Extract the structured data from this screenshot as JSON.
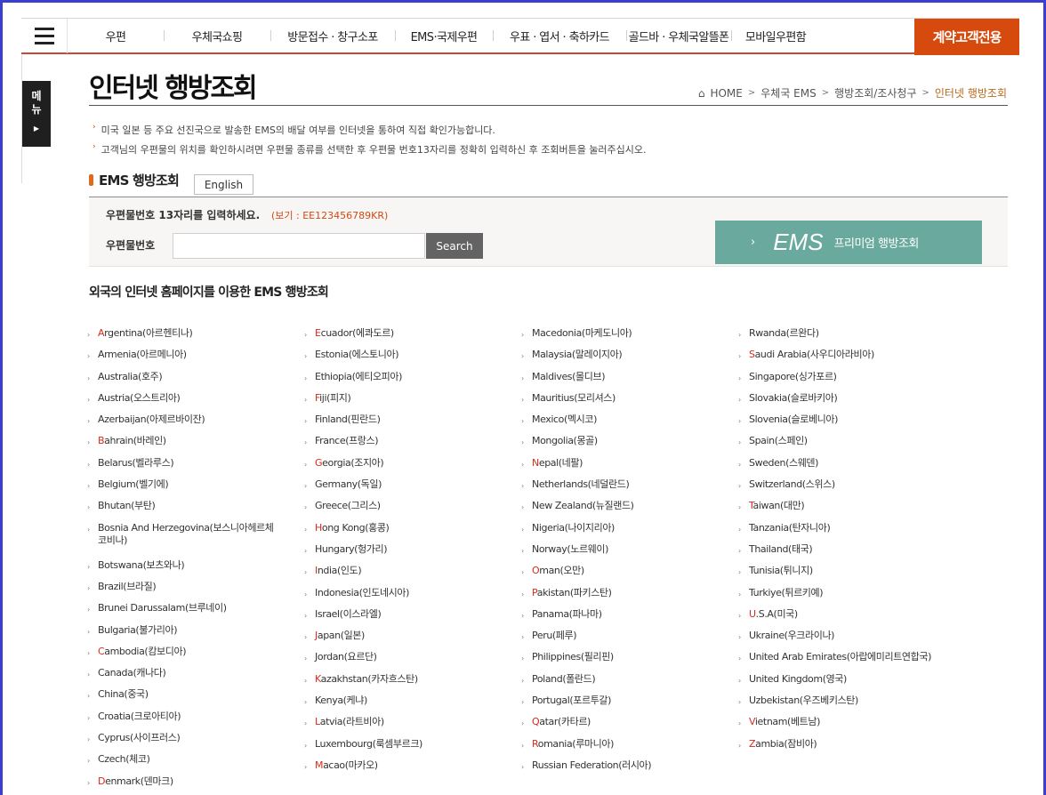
{
  "header": {
    "menu_icon": "hamburger-icon",
    "nav": [
      {
        "label": "우편"
      },
      {
        "label": "우체국쇼핑"
      },
      {
        "label": "방문접수 · 창구소포"
      },
      {
        "label": "EMS·국제우편"
      },
      {
        "label": "우표 · 엽서 · 축하카드"
      },
      {
        "label": "골드바 · 우체국알뜰폰"
      },
      {
        "label": "모바일우편함"
      }
    ],
    "special": "계약고객전용"
  },
  "side_tab": {
    "label1": "메",
    "label2": "뉴",
    "arrow": "▶"
  },
  "page": {
    "title": "인터넷 행방조회",
    "breadcrumb": {
      "home": "HOME",
      "items": [
        "우체국 EMS",
        "행방조회/조사청구"
      ],
      "current": "인터넷 행방조회"
    }
  },
  "notes": [
    "미국 일본 등 주요 선진국으로 발송한 EMS의 배달 여부를 인터넷을 통하여 직접 확인가능합니다.",
    "고객님의 우편물의 위치를 확인하시려면 우편물 종류를 선택한 후 우편물 번호13자리를 정확히 입력하신 후 조회버튼을 눌러주십시오."
  ],
  "ems": {
    "heading": "EMS 행방조회",
    "english_button": "English",
    "prompt": "우편물번호 13자리를 입력하세요.",
    "example": "(보기 : EE123456789KR)",
    "field_label": "우편물번호",
    "input_value": "",
    "search_button": "Search",
    "premium": {
      "chevron": "›",
      "ems": "EMS",
      "label": "프리미엄 행방조회"
    }
  },
  "foreign": {
    "title": "외국의 인터넷 홈페이지를 이용한 EMS 행방조회",
    "columns": [
      [
        {
          "first": "A",
          "rest": "rgentina(아르헨티나)",
          "hl": true
        },
        {
          "first": "A",
          "rest": "rmenia(아르메니아)",
          "hl": false
        },
        {
          "first": "A",
          "rest": "ustralia(호주)",
          "hl": false
        },
        {
          "first": "A",
          "rest": "ustria(오스트리아)",
          "hl": false
        },
        {
          "first": "A",
          "rest": "zerbaijan(아제르바이잔)",
          "hl": false
        },
        {
          "first": "B",
          "rest": "ahrain(바레인)",
          "hl": true
        },
        {
          "first": "B",
          "rest": "elarus(벨라루스)",
          "hl": false
        },
        {
          "first": "B",
          "rest": "elgium(벨기에)",
          "hl": false
        },
        {
          "first": "B",
          "rest": "hutan(부탄)",
          "hl": false
        },
        {
          "first": "B",
          "rest": "osnia And Herzegovina(보스니아헤르체코비나)",
          "hl": false,
          "two": true
        },
        {
          "first": "B",
          "rest": "otswana(보츠와나)",
          "hl": false
        },
        {
          "first": "B",
          "rest": "razil(브라질)",
          "hl": false
        },
        {
          "first": "B",
          "rest": "runei Darussalam(브루네이)",
          "hl": false
        },
        {
          "first": "B",
          "rest": "ulgaria(불가리아)",
          "hl": false
        },
        {
          "first": "C",
          "rest": "ambodia(캄보디아)",
          "hl": true
        },
        {
          "first": "C",
          "rest": "anada(캐나다)",
          "hl": false
        },
        {
          "first": "C",
          "rest": "hina(중국)",
          "hl": false
        },
        {
          "first": "C",
          "rest": "roatia(크로아티아)",
          "hl": false
        },
        {
          "first": "C",
          "rest": "yprus(사이프러스)",
          "hl": false
        },
        {
          "first": "C",
          "rest": "zech(체코)",
          "hl": false
        },
        {
          "first": "D",
          "rest": "enmark(덴마크)",
          "hl": true
        }
      ],
      [
        {
          "first": "E",
          "rest": "cuador(에콰도르)",
          "hl": true
        },
        {
          "first": "E",
          "rest": "stonia(에스토니아)",
          "hl": false
        },
        {
          "first": "E",
          "rest": "thiopia(에티오피아)",
          "hl": false
        },
        {
          "first": "F",
          "rest": "iji(피지)",
          "hl": true
        },
        {
          "first": "F",
          "rest": "inland(핀란드)",
          "hl": false
        },
        {
          "first": "F",
          "rest": "rance(프랑스)",
          "hl": false
        },
        {
          "first": "G",
          "rest": "eorgia(조지아)",
          "hl": true
        },
        {
          "first": "G",
          "rest": "ermany(독일)",
          "hl": false
        },
        {
          "first": "G",
          "rest": "reece(그리스)",
          "hl": false
        },
        {
          "first": "H",
          "rest": "ong Kong(홍콩)",
          "hl": true
        },
        {
          "first": "H",
          "rest": "ungary(헝가리)",
          "hl": false
        },
        {
          "first": "I",
          "rest": "ndia(인도)",
          "hl": true
        },
        {
          "first": "I",
          "rest": "ndonesia(인도네시아)",
          "hl": false
        },
        {
          "first": "I",
          "rest": "srael(이스라엘)",
          "hl": false
        },
        {
          "first": "J",
          "rest": "apan(일본)",
          "hl": true
        },
        {
          "first": "J",
          "rest": "ordan(요르단)",
          "hl": false
        },
        {
          "first": "K",
          "rest": "azakhstan(카자흐스탄)",
          "hl": true
        },
        {
          "first": "K",
          "rest": "enya(케냐)",
          "hl": false
        },
        {
          "first": "L",
          "rest": "atvia(라트비아)",
          "hl": true
        },
        {
          "first": "L",
          "rest": "uxembourg(룩셈부르크)",
          "hl": false
        },
        {
          "first": "M",
          "rest": "acao(마카오)",
          "hl": true
        }
      ],
      [
        {
          "first": "M",
          "rest": "acedonia(마케도니아)",
          "hl": false
        },
        {
          "first": "M",
          "rest": "alaysia(말레이지아)",
          "hl": false
        },
        {
          "first": "M",
          "rest": "aldives(몰디브)",
          "hl": false
        },
        {
          "first": "M",
          "rest": "auritius(모리셔스)",
          "hl": false
        },
        {
          "first": "M",
          "rest": "exico(멕시코)",
          "hl": false
        },
        {
          "first": "M",
          "rest": "ongolia(몽골)",
          "hl": false
        },
        {
          "first": "N",
          "rest": "epal(네팔)",
          "hl": true
        },
        {
          "first": "N",
          "rest": "etherlands(네덜란드)",
          "hl": false
        },
        {
          "first": "N",
          "rest": "ew Zealand(뉴질랜드)",
          "hl": false
        },
        {
          "first": "N",
          "rest": "igeria(나이지리아)",
          "hl": false
        },
        {
          "first": "N",
          "rest": "orway(노르웨이)",
          "hl": false
        },
        {
          "first": "O",
          "rest": "man(오만)",
          "hl": true
        },
        {
          "first": "P",
          "rest": "akistan(파키스탄)",
          "hl": true
        },
        {
          "first": "P",
          "rest": "anama(파나마)",
          "hl": false
        },
        {
          "first": "P",
          "rest": "eru(페루)",
          "hl": false
        },
        {
          "first": "P",
          "rest": "hilippines(필리핀)",
          "hl": false
        },
        {
          "first": "P",
          "rest": "oland(폴란드)",
          "hl": false
        },
        {
          "first": "P",
          "rest": "ortugal(포르투갈)",
          "hl": false
        },
        {
          "first": "Q",
          "rest": "atar(카타르)",
          "hl": true
        },
        {
          "first": "R",
          "rest": "omania(루마니아)",
          "hl": true
        },
        {
          "first": "R",
          "rest": "ussian Federation(러시아)",
          "hl": false
        }
      ],
      [
        {
          "first": "R",
          "rest": "wanda(르완다)",
          "hl": false
        },
        {
          "first": "S",
          "rest": "audi Arabia(사우디아라비아)",
          "hl": true
        },
        {
          "first": "S",
          "rest": "ingapore(싱가포르)",
          "hl": false
        },
        {
          "first": "S",
          "rest": "lovakia(슬로바키아)",
          "hl": false
        },
        {
          "first": "S",
          "rest": "lovenia(슬로베니아)",
          "hl": false
        },
        {
          "first": "S",
          "rest": "pain(스페인)",
          "hl": false
        },
        {
          "first": "S",
          "rest": "weden(스웨덴)",
          "hl": false
        },
        {
          "first": "S",
          "rest": "witzerland(스위스)",
          "hl": false
        },
        {
          "first": "T",
          "rest": "aiwan(대만)",
          "hl": true
        },
        {
          "first": "T",
          "rest": "anzania(탄자니아)",
          "hl": false
        },
        {
          "first": "T",
          "rest": "hailand(태국)",
          "hl": false
        },
        {
          "first": "T",
          "rest": "unisia(튀니지)",
          "hl": false
        },
        {
          "first": "T",
          "rest": "urkiye(튀르키예)",
          "hl": false
        },
        {
          "first": "U",
          "rest": ".S.A(미국)",
          "hl": true
        },
        {
          "first": "U",
          "rest": "kraine(우크라이나)",
          "hl": false
        },
        {
          "first": "U",
          "rest": "nited Arab Emirates(아랍에미리트연합국)",
          "hl": false
        },
        {
          "first": "U",
          "rest": "nited Kingdom(영국)",
          "hl": false
        },
        {
          "first": "U",
          "rest": "zbekistan(우즈베키스탄)",
          "hl": false
        },
        {
          "first": "V",
          "rest": "ietnam(베트남)",
          "hl": true
        },
        {
          "first": "Z",
          "rest": "ambia(잠비아)",
          "hl": true
        }
      ]
    ]
  },
  "colors": {
    "accent": "#d64a0e",
    "premium": "#6aaa9e",
    "highlight": "#d82a1a",
    "frame": "#3b3fcf"
  }
}
